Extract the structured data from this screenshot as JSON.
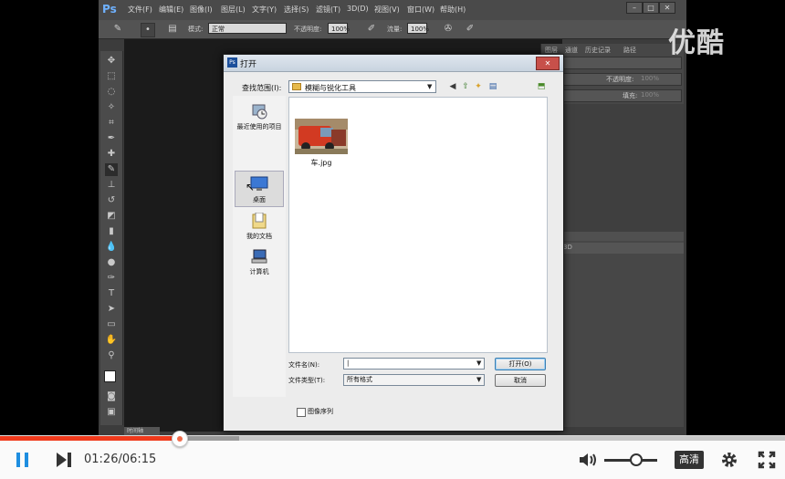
{
  "photoshop": {
    "logo": "Ps",
    "menu": [
      "文件(F)",
      "编辑(E)",
      "图像(I)",
      "图层(L)",
      "文字(Y)",
      "选择(S)",
      "滤镜(T)",
      "3D(D)",
      "视图(V)",
      "窗口(W)",
      "帮助(H)"
    ],
    "options": {
      "mode_label": "模式:",
      "mode_value": "正常",
      "opacity_label": "不透明度:",
      "opacity_value": "100%",
      "flow_label": "流量:",
      "flow_value": "100%"
    },
    "panels": {
      "tabs": [
        "图层",
        "通道",
        "历史记录",
        "路径"
      ],
      "opacity_label": "不透明度:",
      "opacity_value": "100%",
      "fill_label": "填充:",
      "fill_value": "100%",
      "lower_tabs": [
        "消息",
        "3D"
      ]
    },
    "timeline_tab": "时间轴"
  },
  "dialog": {
    "title": "打开",
    "lookin_label": "查找范围(I):",
    "lookin_value": "模糊与锐化工具",
    "places": [
      {
        "label": "最近使用的项目",
        "icon": "recent-items-icon"
      },
      {
        "label": "桌面",
        "icon": "desktop-icon"
      },
      {
        "label": "我的文档",
        "icon": "documents-icon"
      },
      {
        "label": "计算机",
        "icon": "computer-icon"
      }
    ],
    "file": {
      "name": "车.jpg"
    },
    "filename_label": "文件名(N):",
    "filename_value": "|",
    "filetype_label": "文件类型(T):",
    "filetype_value": "所有格式",
    "open_button": "打开(O)",
    "cancel_button": "取消",
    "sequence_label": "图像序列"
  },
  "watermark": "优酷",
  "player": {
    "time": "01:26/06:15",
    "progress_fraction": 0.229,
    "buffer_fraction": 0.305,
    "volume_fraction": 0.6,
    "quality_label": "高清"
  }
}
